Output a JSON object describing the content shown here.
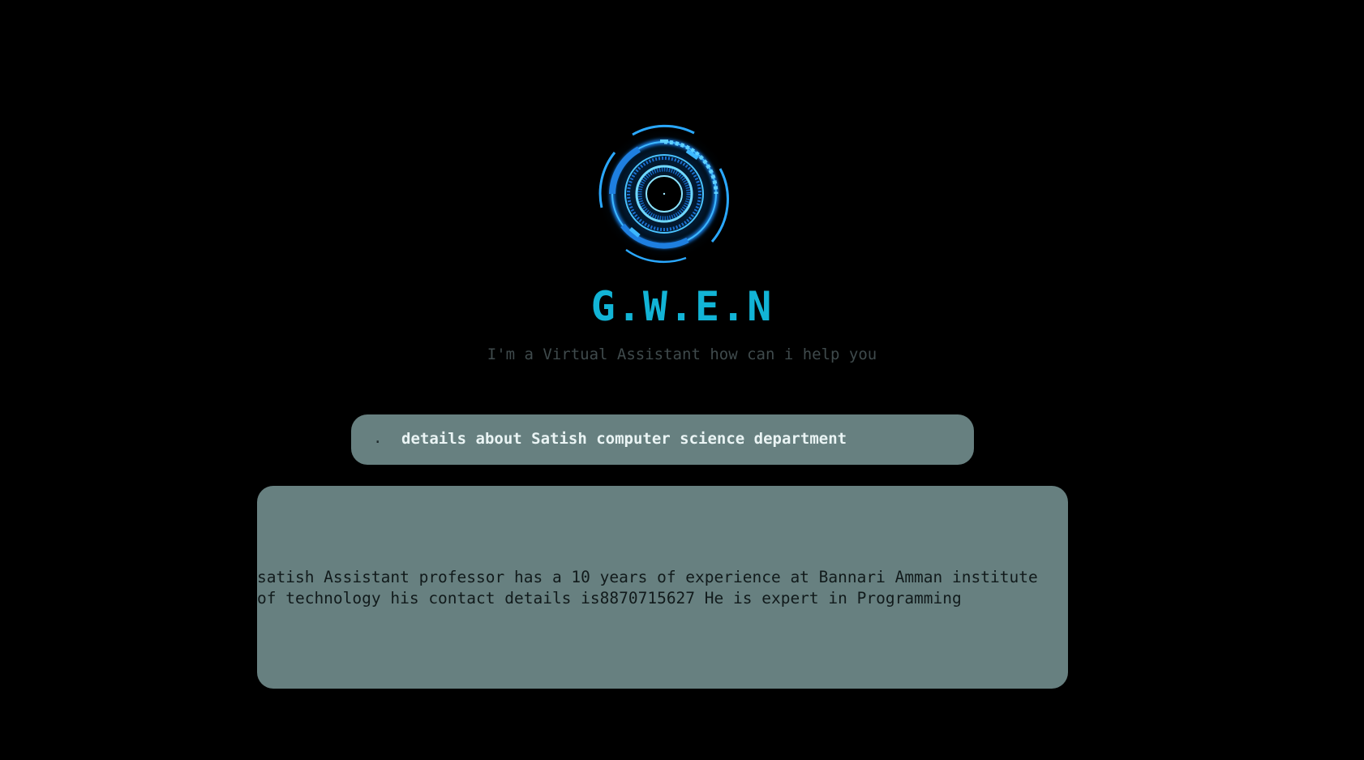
{
  "app": {
    "title": "G.W.E.N",
    "subtitle": "I'm a Virtual Assistant how can i help you",
    "logo_icon": "hud-eye-ring-icon",
    "accent_color": "#12b4d6",
    "background_color": "#000000"
  },
  "query": {
    "indicator": ".",
    "text": "details about Satish computer science department",
    "background_color": "#678080"
  },
  "response": {
    "text": "satish Assistant professor has a 10 years of experience at Bannari Amman institute of technology his contact details is8870715627 He is expert in Programming",
    "background_color": "#678080"
  }
}
